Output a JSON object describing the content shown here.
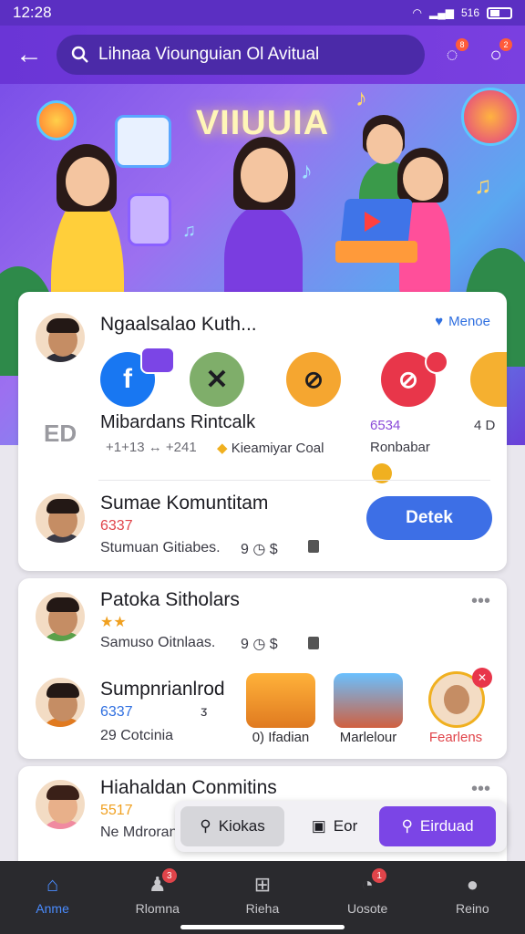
{
  "status": {
    "time": "12:28",
    "battery_text": "516"
  },
  "topbar": {
    "search_text": "Lihnaa Viounguian Ol Avitual",
    "notification_badge": "8",
    "profile_badge": "2"
  },
  "hero": {
    "title": "VIIUUIA"
  },
  "featured": {
    "title": "Ngaalsalao Kuth...",
    "menu_label": "Menoe",
    "side_label": "ED",
    "apps_caption": "Mibardans Rintcalk",
    "stats_left": "+1+13 ↔ +241",
    "stats_mid": "Kieamiyar Coal",
    "stats_right_count": "6534",
    "stats_right_label": "Ronbabar",
    "stats_far_right": "4 D"
  },
  "community1": {
    "title": "Sumae Komuntitam",
    "count": "6337",
    "subtitle": "Stumuan Gitiabes.",
    "meta_num": "9",
    "join_label": "Detek"
  },
  "community2": {
    "title": "Patoka Sitholars",
    "rating": "★★",
    "subtitle": "Samuso Oitnlaas.",
    "meta_num": "9"
  },
  "community3": {
    "title": "Sumpnrianlrod",
    "count": "6337",
    "subtitle": "29 Cotcinia",
    "subtitle_icon": "ᴣ",
    "thumbs": [
      {
        "label": "0) Ifadian"
      },
      {
        "label": "Marlelour"
      },
      {
        "label": "Fearlens"
      }
    ]
  },
  "community4": {
    "title": "Hiahaldan Conmitins",
    "count": "5517",
    "subtitle": "Ne Mdroranu"
  },
  "floatbar": {
    "search_label": "Kiokas",
    "mid_label": "Eor",
    "action_label": "Eirduad"
  },
  "nav": [
    {
      "label": "Anme",
      "badge": ""
    },
    {
      "label": "Rlomna",
      "badge": "3"
    },
    {
      "label": "Rieha",
      "badge": ""
    },
    {
      "label": "Uosote",
      "badge": "1"
    },
    {
      "label": "Reino",
      "badge": ""
    }
  ]
}
